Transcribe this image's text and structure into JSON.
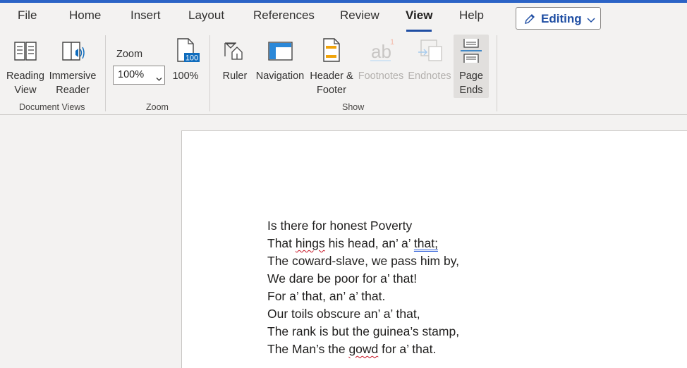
{
  "colors": {
    "accent": "#1f4ea3",
    "top_strip": "#2b63c6",
    "ribbon_bg": "#f3f2f1",
    "page_bg": "#ffffff",
    "spelling": "#c50f1f",
    "grammar": "#2b5cd8"
  },
  "tabs": [
    {
      "label": "File"
    },
    {
      "label": "Home"
    },
    {
      "label": "Insert"
    },
    {
      "label": "Layout"
    },
    {
      "label": "References"
    },
    {
      "label": "Review"
    },
    {
      "label": "View",
      "active": true
    },
    {
      "label": "Help"
    }
  ],
  "editing": {
    "label": "Editing",
    "icon": "pencil-icon"
  },
  "ribbon": {
    "document_views": {
      "reading_view": {
        "line1": "Reading",
        "line2": "View",
        "icon": "book-icon"
      },
      "immersive_reader": {
        "line1": "Immersive",
        "line2": "Reader",
        "icon": "immersive-reader-icon"
      },
      "group_label": "Document Views"
    },
    "zoom": {
      "label": "Zoom",
      "select_value": "100%",
      "button_label": "100%",
      "button_badge": "100",
      "group_label": "Zoom"
    },
    "show": {
      "ruler": {
        "label": "Ruler",
        "icon": "ruler-icon"
      },
      "navigation": {
        "label": "Navigation",
        "icon": "navigation-pane-icon"
      },
      "header_footer": {
        "line1": "Header &",
        "line2": "Footer",
        "icon": "header-footer-icon"
      },
      "footnotes": {
        "label": "Footnotes",
        "icon": "footnotes-icon",
        "glyph": "ab",
        "sup": "1"
      },
      "endnotes": {
        "label": "Endnotes",
        "icon": "endnotes-icon"
      },
      "page_ends": {
        "line1": "Page",
        "line2": "Ends",
        "icon": "page-ends-icon",
        "selected": true
      },
      "group_label": "Show"
    }
  },
  "document": {
    "poem": [
      [
        {
          "t": "Is there for honest Poverty"
        }
      ],
      [
        {
          "t": "That "
        },
        {
          "t": "hings",
          "style": "spell"
        },
        {
          "t": " his head, an’ a’ "
        },
        {
          "t": "that;",
          "style": "grammar"
        }
      ],
      [
        {
          "t": "The coward-slave, we pass him by,"
        }
      ],
      [
        {
          "t": "We dare be poor for a’ that!"
        }
      ],
      [
        {
          "t": "For a’ that, an’ a’ that."
        }
      ],
      [
        {
          "t": "Our toils obscure an’ a’ that,"
        }
      ],
      [
        {
          "t": "The rank is but the guinea’s stamp,"
        }
      ],
      [
        {
          "t": "The Man’s the "
        },
        {
          "t": "gowd",
          "style": "spell"
        },
        {
          "t": " for a’ that."
        }
      ]
    ]
  }
}
